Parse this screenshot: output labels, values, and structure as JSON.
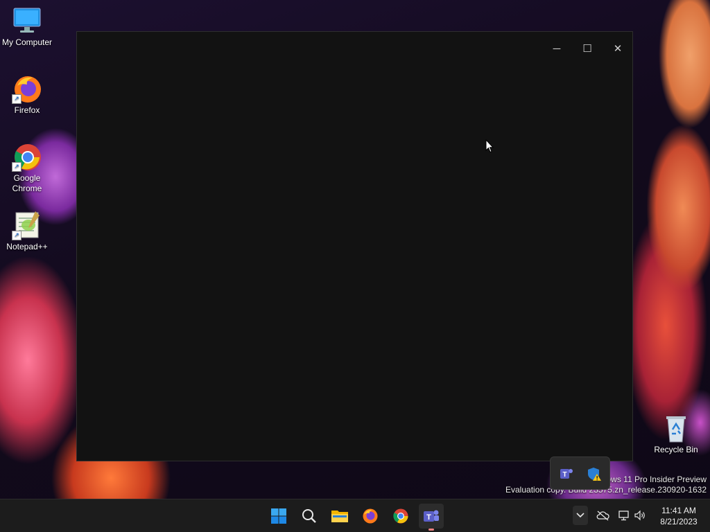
{
  "desktop": {
    "icons": [
      {
        "label": "My Computer",
        "icon": "monitor-icon"
      },
      {
        "label": "Firefox",
        "icon": "firefox-icon"
      },
      {
        "label": "Google Chrome",
        "icon": "chrome-icon"
      },
      {
        "label": "Notepad++",
        "icon": "notepadpp-icon"
      },
      {
        "label": "Recycle Bin",
        "icon": "recycle-bin-icon"
      }
    ]
  },
  "window": {
    "controls": {
      "minimize": "─",
      "maximize": "☐",
      "close": "✕"
    }
  },
  "watermark": {
    "line1": "Windows 11 Pro Insider Preview",
    "line2": "Evaluation copy. Build 23575.zn_release.230920-1632"
  },
  "taskbar": {
    "apps": [
      "start-icon",
      "search-icon",
      "file-explorer-icon",
      "firefox-icon",
      "chrome-icon",
      "teams-icon"
    ],
    "tray": {
      "chevron": "⌃",
      "time": "11:41 AM",
      "date": "8/21/2023"
    }
  },
  "colors": {
    "accent": "#0078d4",
    "window_bg": "#121212",
    "taskbar_bg": "#1c1c1c"
  }
}
